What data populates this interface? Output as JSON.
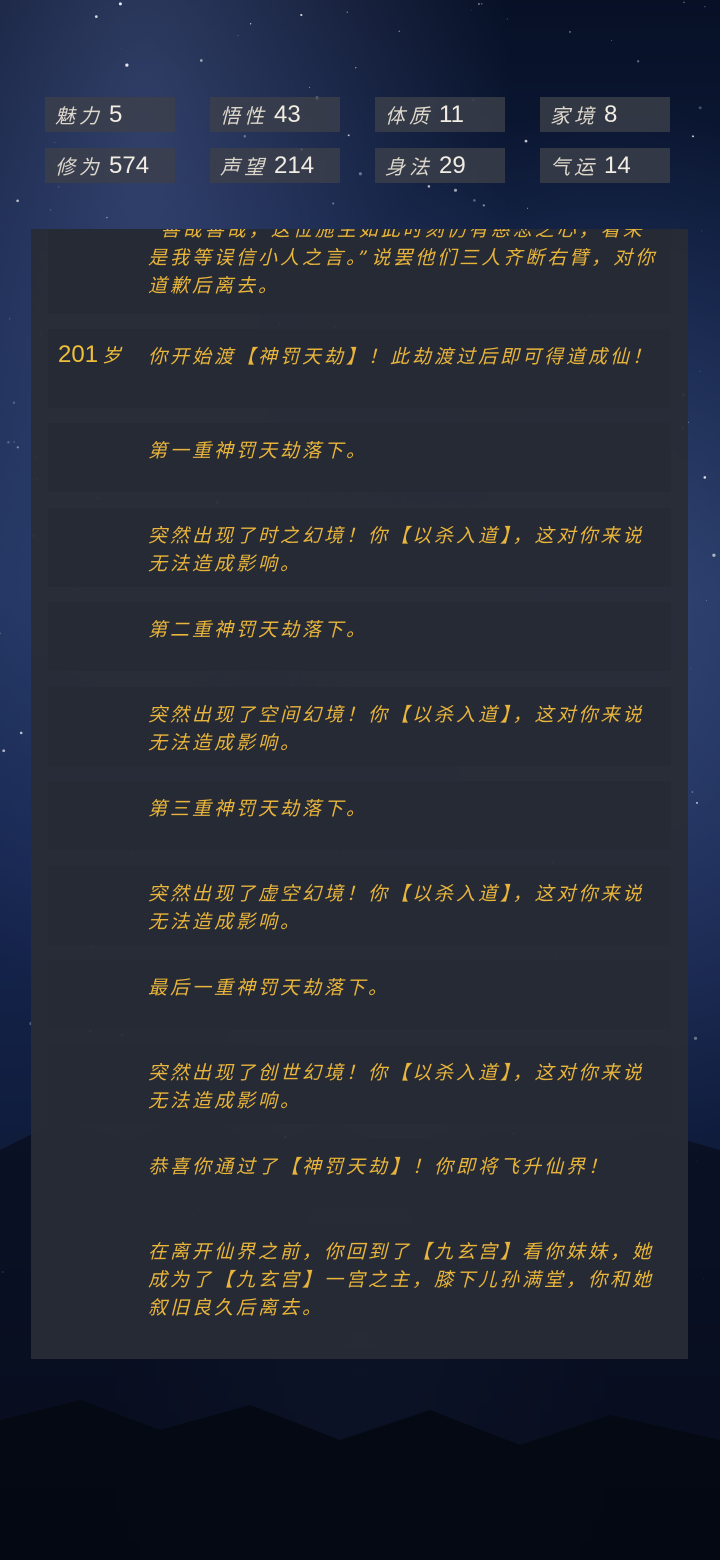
{
  "stats": [
    {
      "label": "魅力",
      "value": "5"
    },
    {
      "label": "悟性",
      "value": "43"
    },
    {
      "label": "体质",
      "value": "11"
    },
    {
      "label": "家境",
      "value": "8"
    },
    {
      "label": "修为",
      "value": "574"
    },
    {
      "label": "声望",
      "value": "214"
    },
    {
      "label": "身法",
      "value": "29"
    },
    {
      "label": "气运",
      "value": "14"
    }
  ],
  "log": [
    {
      "age": "",
      "age_unit": "",
      "text": "“善哉善哉，这位施主如此时刻仍有慈悲之心，看来是我等误信小人之言。”说罢他们三人齐断右臂，对你道歉后离去。"
    },
    {
      "age": "201",
      "age_unit": "岁",
      "text": "你开始渡【神罚天劫】！此劫渡过后即可得道成仙！"
    },
    {
      "age": "",
      "age_unit": "",
      "text": "第一重神罚天劫落下。"
    },
    {
      "age": "",
      "age_unit": "",
      "text": "突然出现了时之幻境！你【以杀入道】，这对你来说无法造成影响。"
    },
    {
      "age": "",
      "age_unit": "",
      "text": "第二重神罚天劫落下。"
    },
    {
      "age": "",
      "age_unit": "",
      "text": "突然出现了空间幻境！你【以杀入道】，这对你来说无法造成影响。"
    },
    {
      "age": "",
      "age_unit": "",
      "text": "第三重神罚天劫落下。"
    },
    {
      "age": "",
      "age_unit": "",
      "text": "突然出现了虚空幻境！你【以杀入道】，这对你来说无法造成影响。"
    },
    {
      "age": "",
      "age_unit": "",
      "text": "最后一重神罚天劫落下。"
    },
    {
      "age": "",
      "age_unit": "",
      "text": "突然出现了创世幻境！你【以杀入道】，这对你来说无法造成影响。"
    },
    {
      "age": "",
      "age_unit": "",
      "text": "恭喜你通过了【神罚天劫】！你即将飞升仙界！"
    },
    {
      "age": "",
      "age_unit": "",
      "text": "在离开仙界之前，你回到了【九玄宫】看你妹妹，她成为了【九玄宫】一宫之主，膝下儿孙满堂，你和她叙旧良久后离去。"
    }
  ]
}
